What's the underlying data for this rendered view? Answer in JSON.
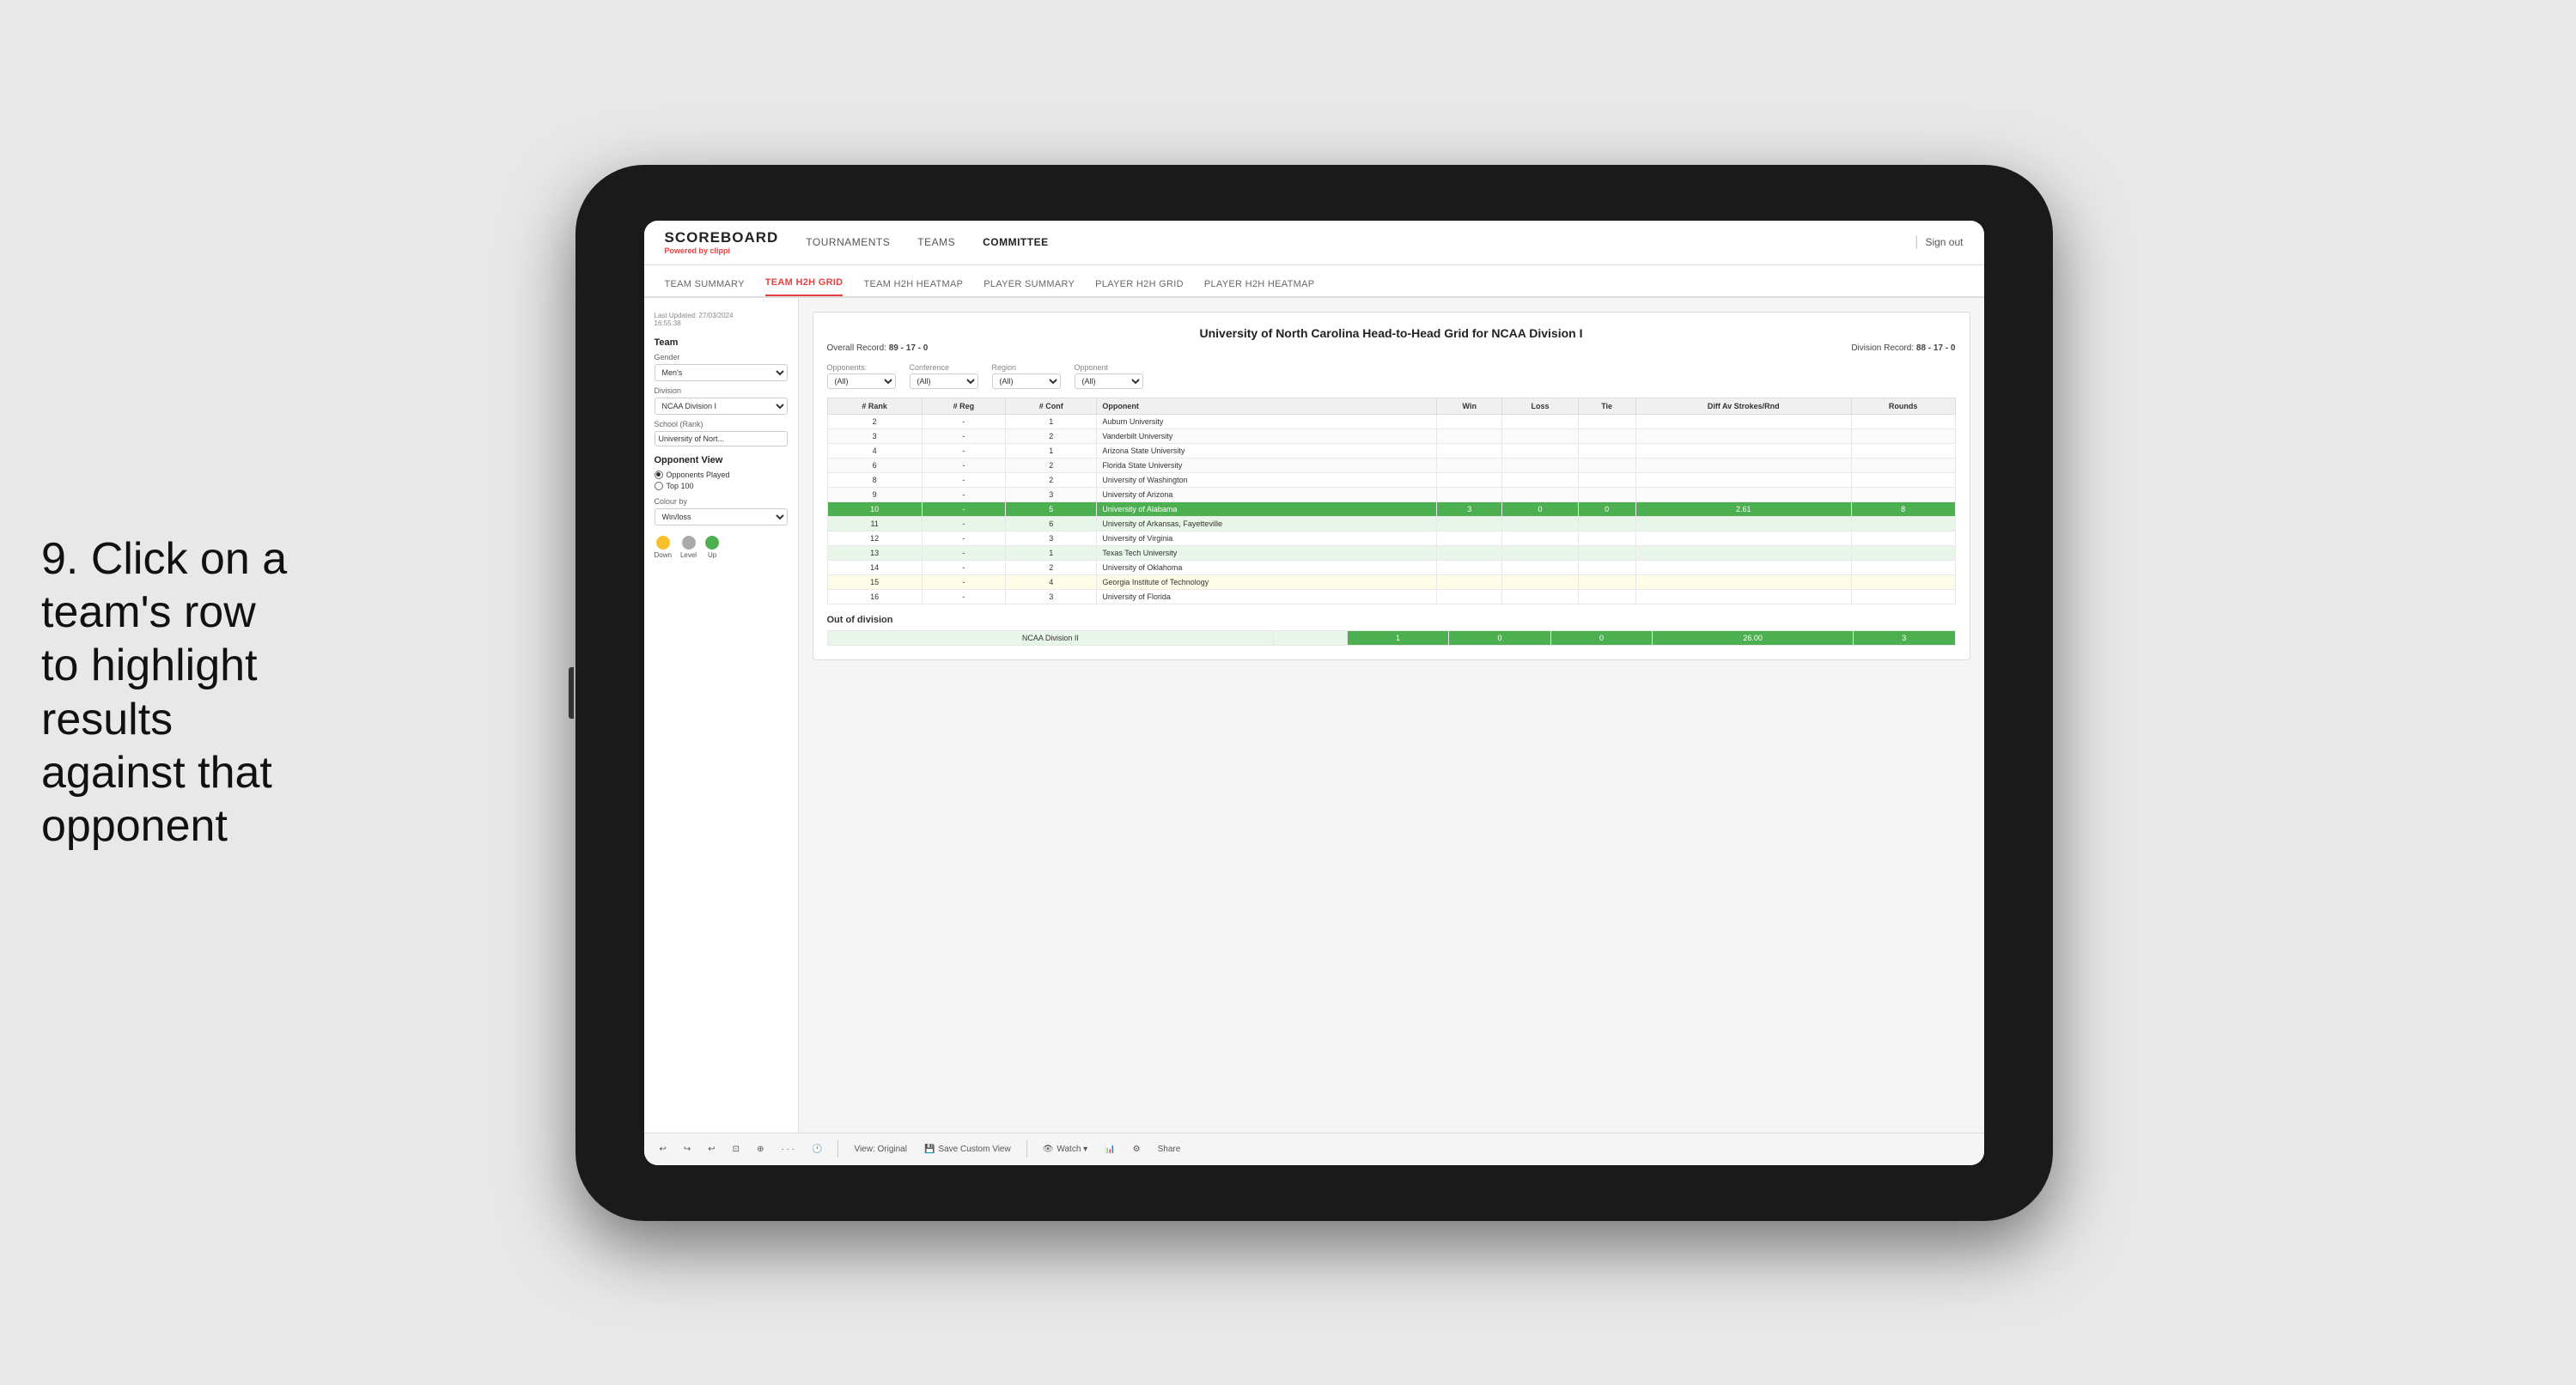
{
  "instruction": {
    "step": "9.",
    "text": "Click on a team's row to highlight results against that opponent"
  },
  "app": {
    "logo": "SCOREBOARD",
    "powered_by": "Powered by",
    "brand": "clippi",
    "sign_out": "Sign out",
    "nav_items": [
      {
        "label": "TOURNAMENTS",
        "active": false
      },
      {
        "label": "TEAMS",
        "active": false
      },
      {
        "label": "COMMITTEE",
        "active": true
      }
    ],
    "sub_nav_items": [
      {
        "label": "TEAM SUMMARY",
        "active": false
      },
      {
        "label": "TEAM H2H GRID",
        "active": true
      },
      {
        "label": "TEAM H2H HEATMAP",
        "active": false
      },
      {
        "label": "PLAYER SUMMARY",
        "active": false
      },
      {
        "label": "PLAYER H2H GRID",
        "active": false
      },
      {
        "label": "PLAYER H2H HEATMAP",
        "active": false
      }
    ]
  },
  "sidebar": {
    "timestamp": "Last Updated: 27/03/2024",
    "time": "16:55:38",
    "team_label": "Team",
    "gender_label": "Gender",
    "gender_value": "Men's",
    "division_label": "Division",
    "division_value": "NCAA Division I",
    "school_label": "School (Rank)",
    "school_value": "University of Nort...",
    "opponent_view_label": "Opponent View",
    "opponent_options": [
      {
        "label": "Opponents Played",
        "selected": true
      },
      {
        "label": "Top 100",
        "selected": false
      }
    ],
    "colour_by_label": "Colour by",
    "colour_by_value": "Win/loss",
    "legend": [
      {
        "label": "Down",
        "color": "#f9c02b"
      },
      {
        "label": "Level",
        "color": "#aaaaaa"
      },
      {
        "label": "Up",
        "color": "#4caf50"
      }
    ]
  },
  "main": {
    "title": "University of North Carolina Head-to-Head Grid for NCAA Division I",
    "overall_record_label": "Overall Record:",
    "overall_record": "89 - 17 - 0",
    "division_record_label": "Division Record:",
    "division_record": "88 - 17 - 0",
    "filters": {
      "opponents_label": "Opponents:",
      "opponents_value": "(All)",
      "conference_label": "Conference",
      "conference_value": "(All)",
      "region_label": "Region",
      "region_value": "(All)",
      "opponent_label": "Opponent",
      "opponent_value": "(All)"
    },
    "table_headers": [
      "# Rank",
      "# Reg",
      "# Conf",
      "Opponent",
      "Win",
      "Loss",
      "Tie",
      "Diff Av Strokes/Rnd",
      "Rounds"
    ],
    "rows": [
      {
        "rank": "2",
        "reg": "-",
        "conf": "1",
        "opponent": "Auburn University",
        "win": "",
        "loss": "",
        "tie": "",
        "diff": "",
        "rounds": "",
        "highlight": "none"
      },
      {
        "rank": "3",
        "reg": "-",
        "conf": "2",
        "opponent": "Vanderbilt University",
        "win": "",
        "loss": "",
        "tie": "",
        "diff": "",
        "rounds": "",
        "highlight": "none"
      },
      {
        "rank": "4",
        "reg": "-",
        "conf": "1",
        "opponent": "Arizona State University",
        "win": "",
        "loss": "",
        "tie": "",
        "diff": "",
        "rounds": "",
        "highlight": "none"
      },
      {
        "rank": "6",
        "reg": "-",
        "conf": "2",
        "opponent": "Florida State University",
        "win": "",
        "loss": "",
        "tie": "",
        "diff": "",
        "rounds": "",
        "highlight": "none"
      },
      {
        "rank": "8",
        "reg": "-",
        "conf": "2",
        "opponent": "University of Washington",
        "win": "",
        "loss": "",
        "tie": "",
        "diff": "",
        "rounds": "",
        "highlight": "none"
      },
      {
        "rank": "9",
        "reg": "-",
        "conf": "3",
        "opponent": "University of Arizona",
        "win": "",
        "loss": "",
        "tie": "",
        "diff": "",
        "rounds": "",
        "highlight": "none"
      },
      {
        "rank": "10",
        "reg": "-",
        "conf": "5",
        "opponent": "University of Alabama",
        "win": "3",
        "loss": "0",
        "tie": "0",
        "diff": "2.61",
        "rounds": "8",
        "highlight": "green"
      },
      {
        "rank": "11",
        "reg": "-",
        "conf": "6",
        "opponent": "University of Arkansas, Fayetteville",
        "win": "",
        "loss": "",
        "tie": "",
        "diff": "",
        "rounds": "",
        "highlight": "light-green"
      },
      {
        "rank": "12",
        "reg": "-",
        "conf": "3",
        "opponent": "University of Virginia",
        "win": "",
        "loss": "",
        "tie": "",
        "diff": "",
        "rounds": "",
        "highlight": "none"
      },
      {
        "rank": "13",
        "reg": "-",
        "conf": "1",
        "opponent": "Texas Tech University",
        "win": "",
        "loss": "",
        "tie": "",
        "diff": "",
        "rounds": "",
        "highlight": "light-green"
      },
      {
        "rank": "14",
        "reg": "-",
        "conf": "2",
        "opponent": "University of Oklahoma",
        "win": "",
        "loss": "",
        "tie": "",
        "diff": "",
        "rounds": "",
        "highlight": "none"
      },
      {
        "rank": "15",
        "reg": "-",
        "conf": "4",
        "opponent": "Georgia Institute of Technology",
        "win": "",
        "loss": "",
        "tie": "",
        "diff": "",
        "rounds": "",
        "highlight": "light-yellow"
      },
      {
        "rank": "16",
        "reg": "-",
        "conf": "3",
        "opponent": "University of Florida",
        "win": "",
        "loss": "",
        "tie": "",
        "diff": "",
        "rounds": "",
        "highlight": "none"
      }
    ],
    "out_of_division_label": "Out of division",
    "out_of_division_row": {
      "label": "NCAA Division II",
      "win": "1",
      "loss": "0",
      "tie": "0",
      "diff": "26.00",
      "rounds": "3"
    }
  },
  "toolbar": {
    "undo": "↩",
    "redo": "↪",
    "view_label": "View: Original",
    "save_custom": "Save Custom View",
    "watch": "Watch ▾",
    "share": "Share"
  }
}
